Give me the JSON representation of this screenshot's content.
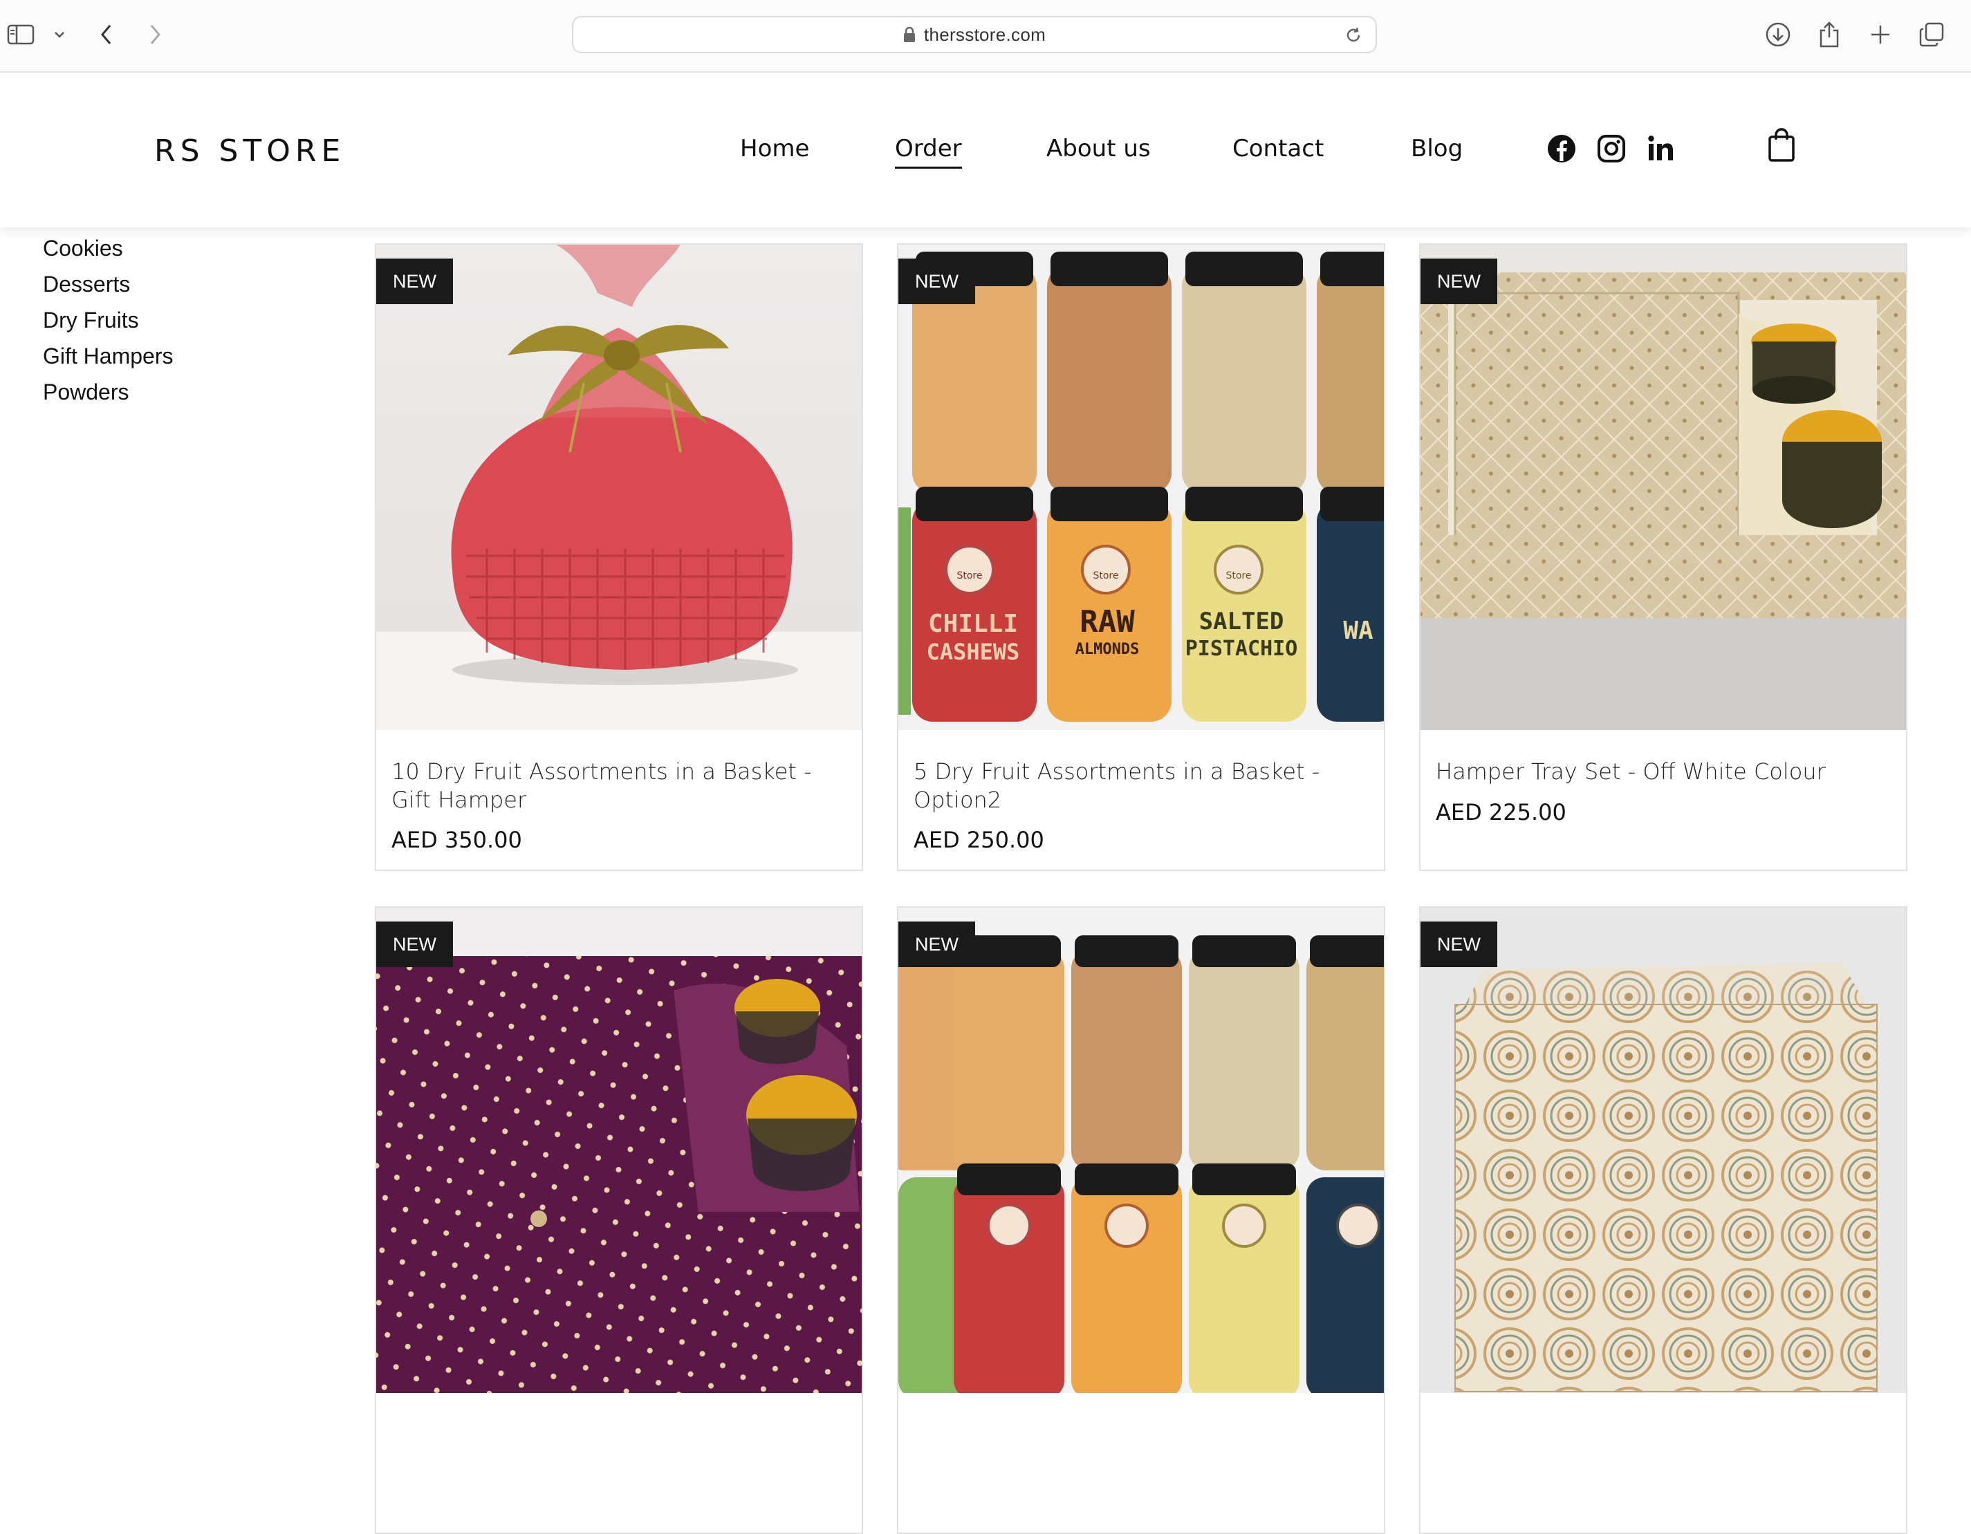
{
  "browser": {
    "url": "thersstore.com"
  },
  "header": {
    "logo": "RS STORE",
    "nav": [
      "Home",
      "Order",
      "About us",
      "Contact",
      "Blog"
    ],
    "active_nav": "Order"
  },
  "sidebar": {
    "categories": [
      "Cookies",
      "Desserts",
      "Dry Fruits",
      "Gift Hampers",
      "Powders"
    ]
  },
  "products": [
    {
      "badge": "NEW",
      "name": "10 Dry Fruit Assortments in a Basket - Gift Hamper",
      "price": "AED 350.00"
    },
    {
      "badge": "NEW",
      "name": "5 Dry Fruit Assortments in a Basket - Option2",
      "price": "AED 250.00"
    },
    {
      "badge": "NEW",
      "name": "Hamper Tray Set - Off White Colour",
      "price": "AED 225.00"
    },
    {
      "badge": "NEW",
      "name": "",
      "price": ""
    },
    {
      "badge": "NEW",
      "name": "",
      "price": ""
    },
    {
      "badge": "NEW",
      "name": "",
      "price": ""
    }
  ],
  "jar_labels": {
    "l1a": "CHILLI",
    "l1b": "CASHEWS",
    "l2a": "RAW",
    "l2b": "ALMONDS",
    "l3a": "SALTED",
    "l3b": "PISTACHIO",
    "l4": "WA",
    "brand": "Store"
  },
  "colors": {
    "badge_bg": "#1a1a1a",
    "basket_red": "#d9484f",
    "ribbon_gold": "#a08a2e",
    "tray_beige": "#d9c9a6",
    "tray_purple": "#5b1745",
    "lid_gold": "#e1a51f"
  },
  "icons": [
    "sidebar-toggle-icon",
    "chevron-down-icon",
    "back-icon",
    "forward-icon",
    "lock-icon",
    "reload-icon",
    "download-icon",
    "share-icon",
    "new-tab-icon",
    "tabs-icon",
    "facebook-icon",
    "instagram-icon",
    "linkedin-icon",
    "shopping-bag-icon"
  ]
}
